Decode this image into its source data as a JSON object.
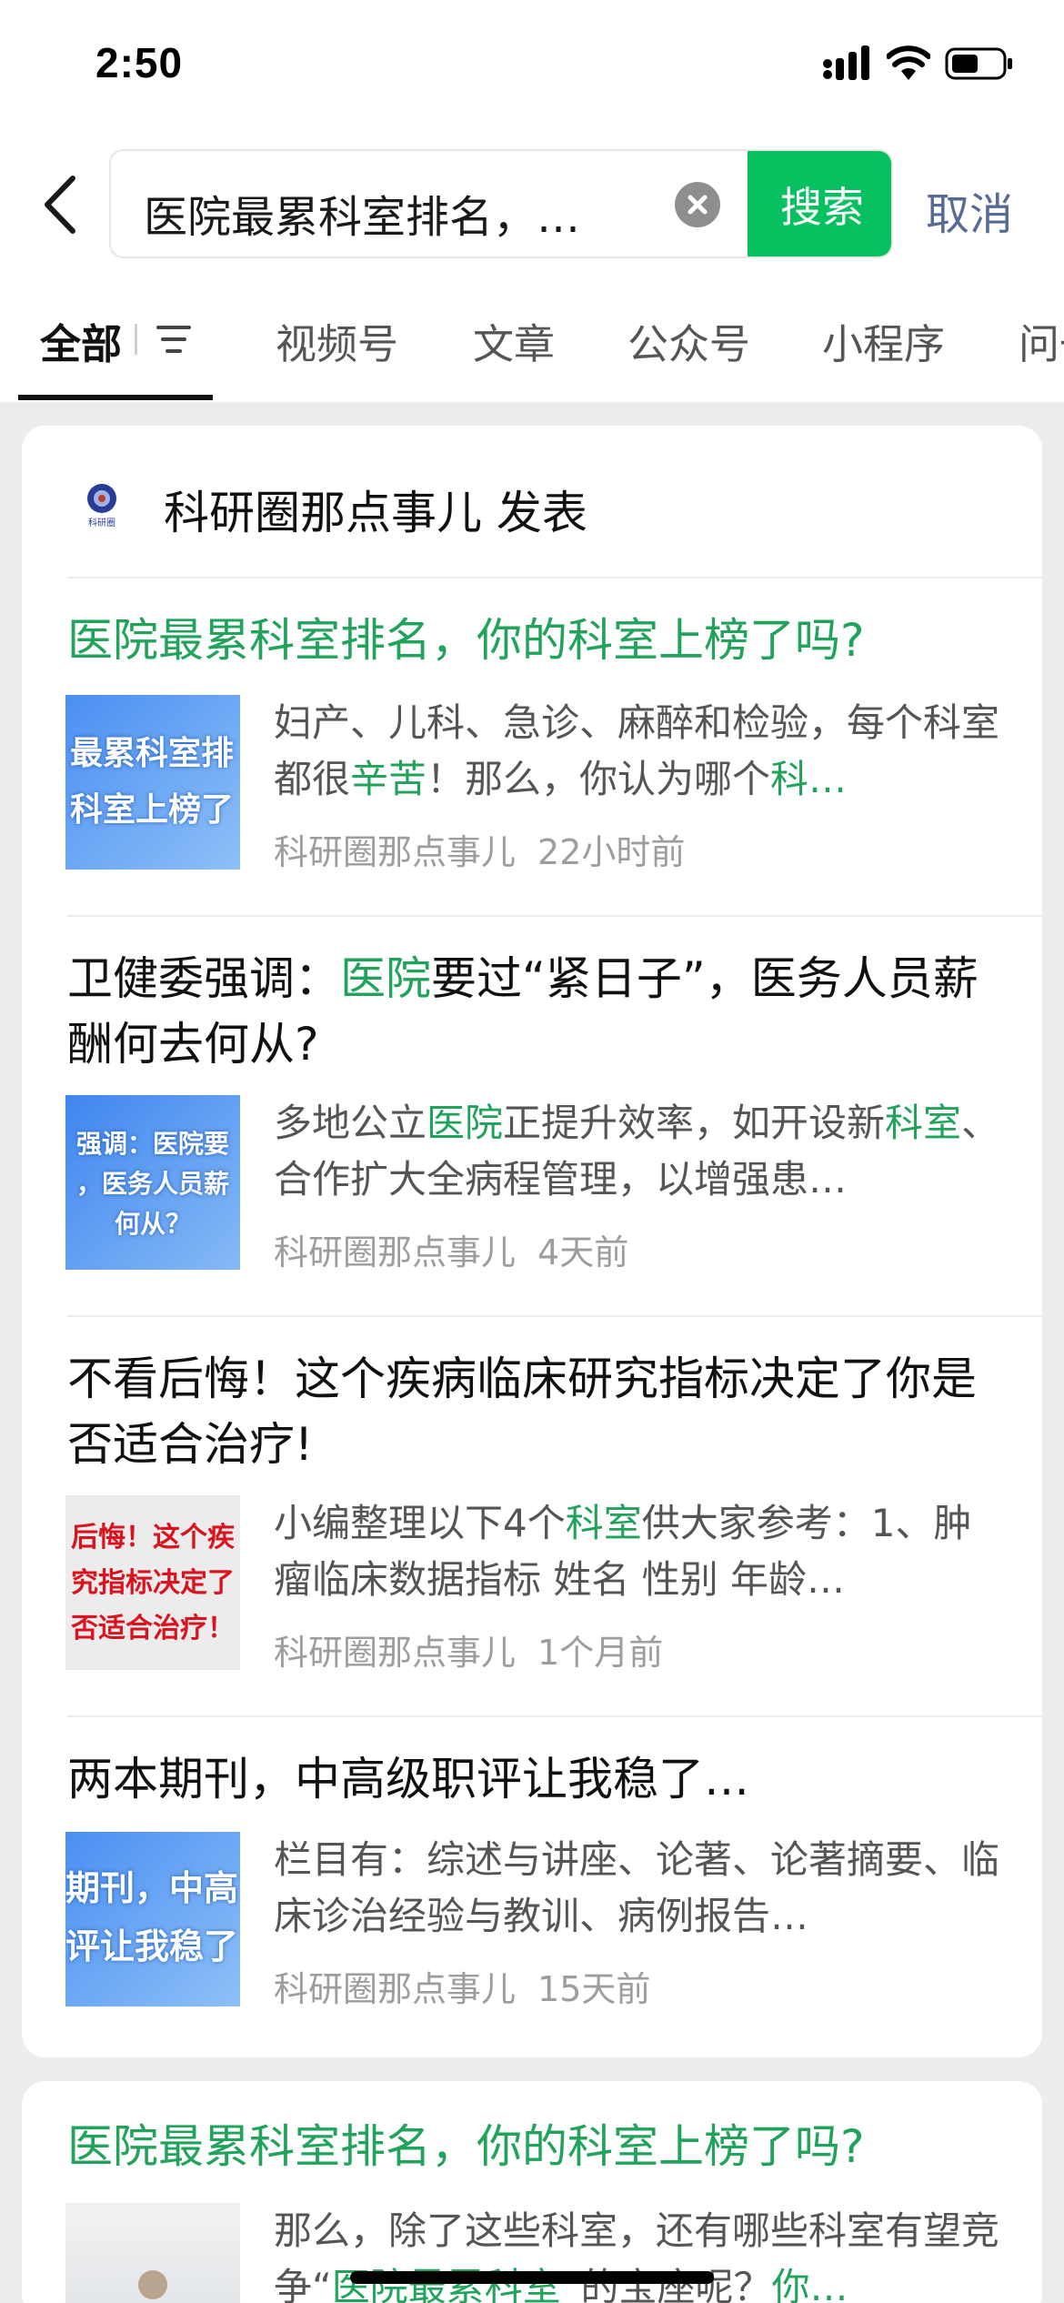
{
  "status_bar": {
    "time": "2:50"
  },
  "search": {
    "query": "医院最累科室排名，…",
    "button_label": "搜索",
    "cancel_label": "取消"
  },
  "tabs": [
    {
      "label": "全部",
      "active": true
    },
    {
      "label": "视频号"
    },
    {
      "label": "文章"
    },
    {
      "label": "公众号"
    },
    {
      "label": "小程序"
    },
    {
      "label": "问一"
    }
  ],
  "card1": {
    "author": "科研圈那点事儿 发表",
    "avatar_text": "科研圈",
    "articles": [
      {
        "title": "医院最累科室排名，你的科室上榜了吗?",
        "thumb_lines": [
          "最累科室排",
          "科室上榜了"
        ],
        "snippet_a": "妇产、儿科、急诊、麻醉和检验，每个科室都很",
        "snippet_hl1": "辛苦",
        "snippet_b": "！那么，你认为哪个",
        "snippet_hl2": "科…",
        "source": "科研圈那点事儿",
        "time": "22小时前"
      },
      {
        "title_a": "卫健委强调：",
        "title_hl": "医院",
        "title_b": "要过“紧日子”，医务人员薪酬何去何从?",
        "thumb_lines": [
          "强调：医院要",
          "，医务人员薪",
          "何从？"
        ],
        "snippet_a": "多地公立",
        "snippet_hl1": "医院",
        "snippet_b": "正提升效率，如开设新",
        "snippet_hl2": "科室",
        "snippet_c": "、合作扩大全病程管理，以增强患…",
        "source": "科研圈那点事儿",
        "time": "4天前"
      },
      {
        "title": "不看后悔！这个疾病临床研究指标决定了你是否适合治疗!",
        "thumb_lines": [
          "后悔！这个疾",
          "究指标决定了",
          "否适合治疗！"
        ],
        "snippet_a": "小编整理以下4个",
        "snippet_hl1": "科室",
        "snippet_b": "供大家参考：1、肿瘤临床数据指标 姓名 性别 年龄…",
        "source": "科研圈那点事儿",
        "time": "1个月前"
      },
      {
        "title": "两本期刊，中高级职评让我稳了…",
        "thumb_lines": [
          "期刊，中高",
          "评让我稳了"
        ],
        "snippet_a": "栏目有：综述与讲座、论著、论著摘要、临床诊治经验与教训、病例报告…",
        "source": "科研圈那点事儿",
        "time": "15天前"
      }
    ]
  },
  "card2": {
    "title": "医院最累科室排名，你的科室上榜了吗?",
    "snippet_a": "那么，除了这些科室，还有哪些科室有望竞争“",
    "snippet_hl1": "医院最累科室",
    "snippet_b": "”的宝座呢？",
    "snippet_hl2": "你…"
  },
  "colors": {
    "accent_green": "#07c160",
    "highlight_green": "#21a35b",
    "link_blue": "#576b95",
    "thumb_blue": "#3b8ef0",
    "thumb_gray": "#e8e8e8"
  }
}
